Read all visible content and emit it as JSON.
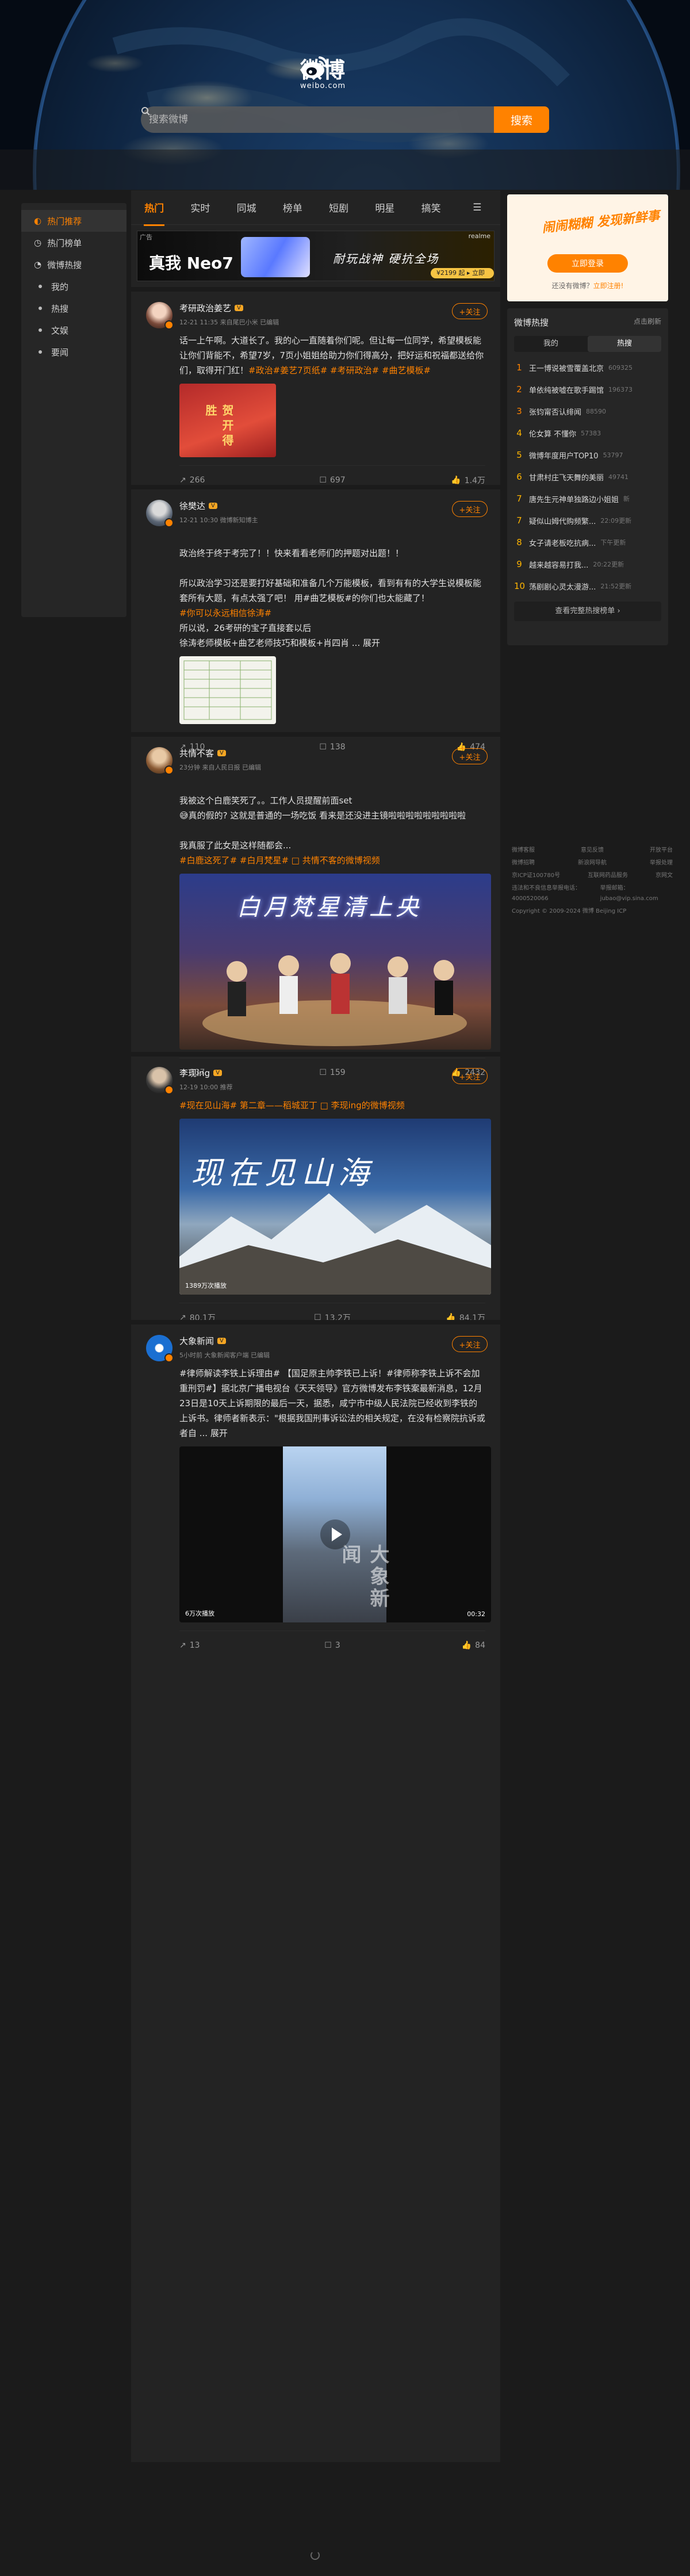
{
  "logo": {
    "cn": "微博",
    "en": "weibo.com"
  },
  "search": {
    "placeholder": "搜索微博",
    "button": "搜索"
  },
  "leftnav": {
    "items": [
      {
        "label": "热门推荐",
        "icon": "fire-icon"
      },
      {
        "label": "热门榜单",
        "icon": "list-icon"
      },
      {
        "label": "微博热搜",
        "icon": "search-icon"
      }
    ],
    "sub": [
      "我的",
      "热搜",
      "文娱",
      "要闻"
    ]
  },
  "tabs": [
    "热门",
    "实时",
    "同城",
    "榜单",
    "短剧",
    "明星",
    "搞笑",
    "☰"
  ],
  "ad": {
    "tag": "广告",
    "brand": "realme",
    "headline": "真我 Neo7",
    "slogan": "耐玩战神 硬抗全场",
    "price": "¥2199 起 ▸ 立即抢购"
  },
  "posts": [
    {
      "name": "考研政治姜艺",
      "level": "V",
      "meta": "12-21 11:35 来自尾巴小米 已编辑",
      "follow": "+关注",
      "text": "话一上午啊。大道长了。我的心一直随着你们呢。但让每一位同学，希望模板能让你们背能不，希望7岁，7页小姐姐给助力你们得高分，把好运和祝福都送给你们，取得开门红！",
      "tags": "#政治#姜艺7页纸# #考研政治# #曲艺模板#",
      "media_label": "贺开得胜",
      "share": "266",
      "comment": "697",
      "like": "1.4万"
    },
    {
      "name": "徐樊达",
      "level": "V",
      "meta": "12-21 10:30 微博新知博主",
      "follow": "+关注",
      "text": "政治终于终于考完了！！快来看看老师们的押题对出题！！\n\n所以政治学习还是要打好基础和准备几个万能模板，看到有有的大学生说模板能套所有大题，有点太强了吧！ 用#曲艺模板#的你们也太能藏了！",
      "tags": "#你可以永远相信徐涛#",
      "text2": "所以说，26考研的宝子直接套以后\n徐涛老师模板+曲艺老师技巧和模板+肖四肖 ... 展开",
      "share": "110",
      "comment": "138",
      "like": "474"
    },
    {
      "name": "共情不客",
      "level": "V",
      "meta": "23分钟 来自人民日报 已编辑",
      "follow": "+关注",
      "text": "我被这个白鹿笑死了。。工作人员提醒前面set\n😅真的假的? 这就是普通的一场吃饭 看来是还没进主镜啦啦啦啦啦啦啦啦啦\n\n我真服了此女是这样随都会...",
      "tags": "#白鹿这死了# #白月梵星# □ 共情不客的微博视频",
      "video_title": "白月梵星清上央",
      "share": "337",
      "comment": "159",
      "like": "2432"
    },
    {
      "name": "李现ing",
      "level": "V",
      "meta": "12-19 10:00 推荐",
      "follow": "+关注",
      "text": "#现在见山海# 第二章——稻城亚丁 □ 李现ing的微博视频",
      "video_title": "现在见山海",
      "views": "1389万次播放",
      "share": "80.1万",
      "comment": "13.2万",
      "like": "84.1万"
    },
    {
      "name": "大象新闻",
      "level": "V",
      "meta": "5小时前 大象新闻客户端 已编辑",
      "follow": "+关注",
      "text": "#律师解读李铁上诉理由# 【国足原主帅李铁已上诉！#律师称李铁上诉不会加重刑罚#】据北京广播电视台《天天领导》官方微博发布李铁案最新消息，12月23日是10天上诉期限的最后一天，据悉，咸宁市中级人民法院已经收到李铁的上诉书。律师者新表示：\"根据我国刑事诉讼法的相关规定，在没有检察院抗诉或者自 ... 展开",
      "video_title": "大象新闻",
      "views": "6万次播放",
      "duration": "00:32",
      "share": "13",
      "comment": "3",
      "like": "84"
    }
  ],
  "rightad": {
    "headline": "闹闹糊糊 发现新鲜事",
    "button": "立即登录",
    "sub_prefix": "还没有微博？",
    "sub_link": "立即注册!"
  },
  "hot": {
    "title": "微博热搜",
    "hide": "点击刷新",
    "seg": [
      "我的",
      "热搜"
    ],
    "items": [
      {
        "n": "1",
        "k": "王一博说被雪覆盖北京",
        "c": "609325"
      },
      {
        "n": "2",
        "k": "单依纯被嘘在歌手踢馆",
        "c": "196373"
      },
      {
        "n": "3",
        "k": "张钧甯否认绯闻",
        "c": "88590"
      },
      {
        "n": "4",
        "k": "伦女算 不懂你",
        "c": "57383"
      },
      {
        "n": "5",
        "k": "微博年度用户TOP10",
        "c": "53797"
      },
      {
        "n": "6",
        "k": "甘肃村庄飞天舞的美丽",
        "c": "49741"
      },
      {
        "n": "7",
        "k": "唐先生元神单独路边小姐姐",
        "c": "新"
      },
      {
        "n": "7",
        "k": "疑似山姆代购频繁...",
        "c": "22:09更新"
      },
      {
        "n": "8",
        "k": "女子请老板吃抗病...",
        "c": "下午更新"
      },
      {
        "n": "9",
        "k": "越来越容易打我...",
        "c": "20:22更新"
      },
      {
        "n": "10",
        "k": "荡剧剧心灵太漫游...",
        "c": "21:52更新"
      }
    ],
    "more": "查看完整热搜榜单 ›"
  },
  "footer": {
    "rows": [
      [
        "微博客服",
        "意见反馈",
        "开放平台"
      ],
      [
        "微博招聘",
        "新浪网导航",
        "举报处理"
      ],
      [
        "京ICP证100780号",
        "互联网药品服务",
        "京网文"
      ],
      [
        "违法和不良信息举报电话：4000520066",
        "举报邮箱：jubao@vip.sina.com"
      ],
      [
        "Copyright © 2009-2024 微博 Beijing ICP"
      ]
    ]
  },
  "colors": {
    "accent": "#ff8200",
    "bg": "#1b1b1b",
    "panel": "#262626"
  }
}
